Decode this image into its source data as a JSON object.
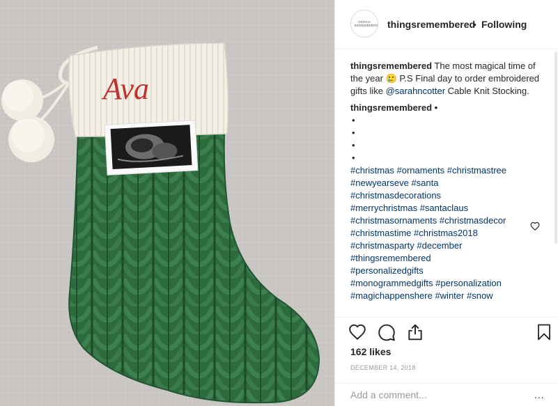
{
  "post": {
    "photo_alt": "green cable knit christmas stocking",
    "stocking_name": "Ava"
  },
  "header": {
    "avatar_text": "THINGS REMEMBERED",
    "username": "thingsremembered",
    "separator": "•",
    "follow_status": "Following"
  },
  "caption": {
    "username": "thingsremembered",
    "text_part1": " The most magical time of the year 🥲 P.S Final day to order embroidered gifts like ",
    "mention": "@sarahncotter",
    "text_part2": " Cable Knit Stocking."
  },
  "comment": {
    "username": "thingsremembered •",
    "dots": [
      "•",
      "•",
      "•",
      "•"
    ],
    "hashtag_lines": [
      [
        "#christmas",
        "#ornaments",
        "#christmastree"
      ],
      [
        "#newyearseve",
        "#santa"
      ],
      [
        "#christmasdecorations"
      ],
      [
        "#merrychristmas",
        "#santaclaus"
      ],
      [
        "#christmasornaments",
        "#christmasdecor"
      ],
      [
        "#christmastime",
        "#christmas2018"
      ],
      [
        "#christmasparty",
        "#december"
      ],
      [
        "#thingsremembered"
      ],
      [
        "#personalizedgifts"
      ],
      [
        "#monogrammedgifts",
        "#personalization"
      ],
      [
        "#magichappenshere",
        "#winter",
        "#snow"
      ]
    ]
  },
  "actions": {
    "like_icon": "heart-icon",
    "comment_icon": "comment-bubble-icon",
    "share_icon": "share-icon",
    "save_icon": "bookmark-icon"
  },
  "likes": "162 likes",
  "date": "DECEMBER 14, 2018",
  "add_comment": {
    "placeholder": "Add a comment...",
    "more_label": "..."
  },
  "colors": {
    "link": "#003569",
    "stocking_green": "#2e6b3c",
    "cuff_white": "#f3efe6",
    "embroidery_red": "#c0322e",
    "background_photo": "#c9c6c4"
  }
}
